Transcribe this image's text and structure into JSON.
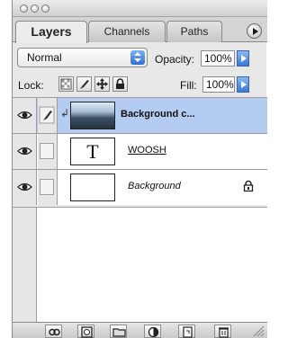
{
  "tabs": [
    {
      "label": "Layers",
      "active": true
    },
    {
      "label": "Channels",
      "active": false
    },
    {
      "label": "Paths",
      "active": false
    }
  ],
  "blend": {
    "mode": "Normal",
    "opacity_label": "Opacity:",
    "opacity_value": "100%"
  },
  "lock": {
    "label": "Lock:",
    "fill_label": "Fill:",
    "fill_value": "100%"
  },
  "layers": [
    {
      "name": "Background c...",
      "thumbnail": "photo",
      "selected": true
    },
    {
      "name": "WOOSH",
      "thumbnail": "T",
      "selected": false
    },
    {
      "name": "Background",
      "thumbnail": "blank",
      "selected": false,
      "locked": true
    }
  ],
  "icons": {
    "eye": "eye-icon",
    "brush": "brush-icon",
    "lock": "lock-icon"
  },
  "colors": {
    "selected_row": "#b4ccf2",
    "accent": "#3a78d6"
  }
}
